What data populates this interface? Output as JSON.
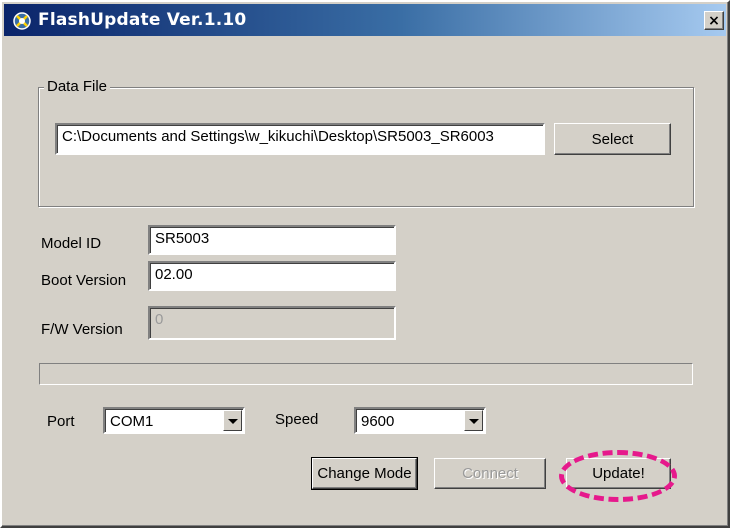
{
  "window": {
    "title": "FlashUpdate Ver.1.10",
    "close_label": "×"
  },
  "data_file": {
    "group_label": "Data File",
    "path": "C:\\Documents and Settings\\w_kikuchi\\Desktop\\SR5003_SR6003",
    "select_label": "Select"
  },
  "info": {
    "model_id_label": "Model ID",
    "model_id_value": "SR5003",
    "boot_version_label": "Boot Version",
    "boot_version_value": "02.00",
    "fw_version_label": "F/W Version",
    "fw_version_value": "0"
  },
  "progress": {
    "value": 0
  },
  "settings": {
    "port_label": "Port",
    "port_value": "COM1",
    "speed_label": "Speed",
    "speed_value": "9600"
  },
  "actions": {
    "change_mode_label": "Change Mode",
    "connect_label": "Connect",
    "update_label": "Update!"
  },
  "colors": {
    "titlebar_start": "#0a246a",
    "titlebar_end": "#a6caf0",
    "window_face": "#d4d0c8",
    "highlight": "#e6198c"
  }
}
